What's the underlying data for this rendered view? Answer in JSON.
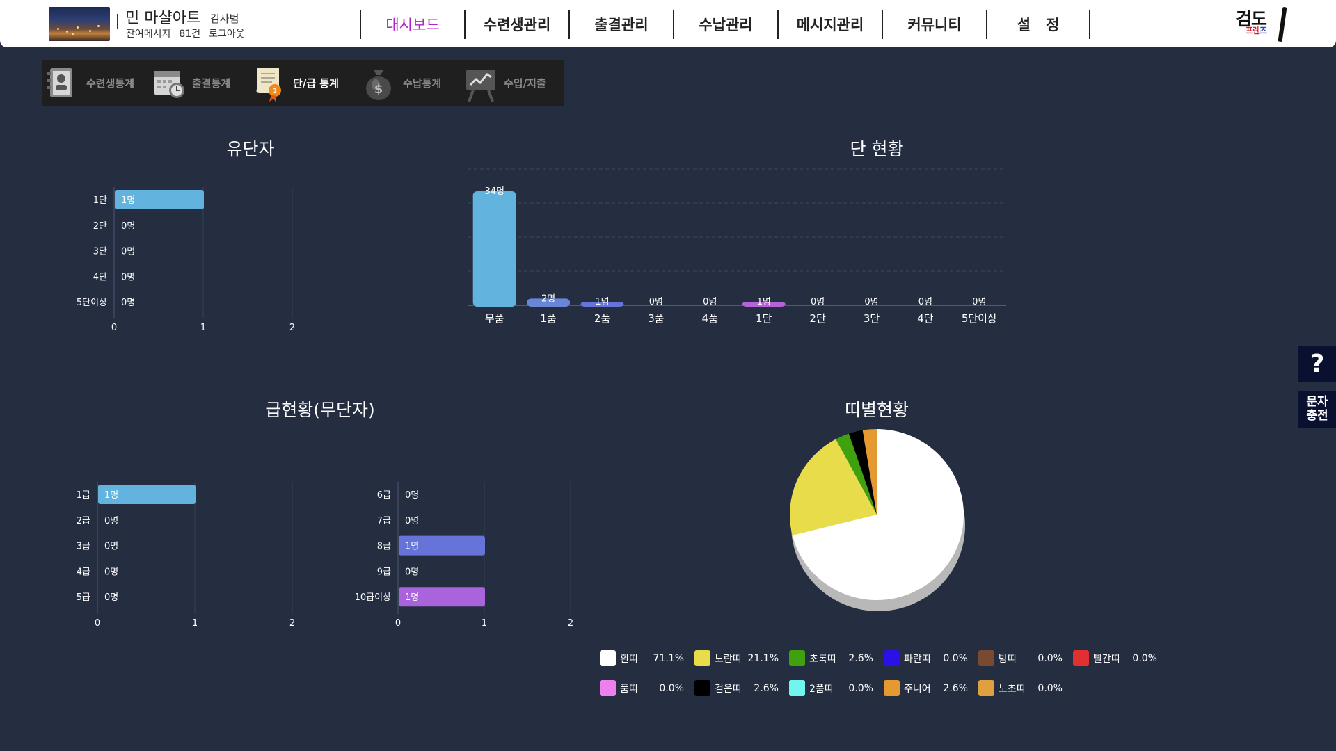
{
  "header": {
    "gym_name": "민 마샬아트",
    "owner": "김사범",
    "remaining_label": "잔여메시지",
    "remaining_count": "81건",
    "logout": "로그아웃",
    "nav": [
      "대시보드",
      "수련생관리",
      "출결관리",
      "수납관리",
      "메시지관리",
      "커뮤니티",
      "설   정"
    ],
    "logo_top": "검도",
    "logo_bottom_red": "프렌",
    "logo_bottom_blue": "즈"
  },
  "stat_tabs": [
    {
      "label": "수련생통계",
      "icon": "id-card-icon"
    },
    {
      "label": "출결통계",
      "icon": "calendar-clock-icon"
    },
    {
      "label": "단/급 통계",
      "icon": "certificate-icon"
    },
    {
      "label": "수납통계",
      "icon": "money-bag-icon"
    },
    {
      "label": "수입/지출",
      "icon": "chart-board-icon"
    }
  ],
  "active_tab": 2,
  "side": {
    "help": "?",
    "sms_line1": "문자",
    "sms_line2": "충전"
  },
  "colors": {
    "background": "#252d40",
    "header": "#ffffff",
    "active_nav": "#b121c9",
    "bar_blue": "#62b3dd",
    "bar_indigo": "#6673d8",
    "bar_purple": "#a963db"
  },
  "chart_data": [
    {
      "id": "yudanja",
      "type": "bar",
      "orientation": "horizontal",
      "title": "유단자",
      "categories": [
        "1단",
        "2단",
        "3단",
        "4단",
        "5단이상"
      ],
      "values": [
        1,
        0,
        0,
        0,
        0
      ],
      "data_labels": [
        "1명",
        "0명",
        "0명",
        "0명",
        "0명"
      ],
      "xlim": [
        0,
        2
      ],
      "xticks": [
        "0",
        "1",
        "2"
      ],
      "color": "#62b3dd"
    },
    {
      "id": "dan_status",
      "type": "bar",
      "title": "단 현황",
      "categories": [
        "무품",
        "1품",
        "2품",
        "3품",
        "4품",
        "1단",
        "2단",
        "3단",
        "4단",
        "5단이상"
      ],
      "values": [
        34,
        2,
        1,
        0,
        0,
        1,
        0,
        0,
        0,
        0
      ],
      "data_labels": [
        "34명",
        "2명",
        "1명",
        "0명",
        "0명",
        "1명",
        "0명",
        "0명",
        "0명",
        "0명"
      ],
      "ylim": [
        0,
        34
      ],
      "grid": true,
      "colors": [
        "#62b3dd",
        "#6985d8",
        "#6673d8",
        "#6a6bd8",
        "#7a67d8",
        "#b463d8",
        "#c060c0",
        "#c85aa8",
        "#cf5a95",
        "#d55c85"
      ]
    },
    {
      "id": "geup_status",
      "type": "bar",
      "orientation": "horizontal",
      "title": "급현황(무단자)",
      "panels": [
        {
          "categories": [
            "1급",
            "2급",
            "3급",
            "4급",
            "5급"
          ],
          "values": [
            1,
            0,
            0,
            0,
            0
          ],
          "data_labels": [
            "1명",
            "0명",
            "0명",
            "0명",
            "0명"
          ],
          "colors": [
            "#62b3dd",
            "#62b3dd",
            "#62b3dd",
            "#62b3dd",
            "#62b3dd"
          ]
        },
        {
          "categories": [
            "6급",
            "7급",
            "8급",
            "9급",
            "10급이상"
          ],
          "values": [
            0,
            0,
            1,
            0,
            1
          ],
          "data_labels": [
            "0명",
            "0명",
            "1명",
            "0명",
            "1명"
          ],
          "colors": [
            "#6673d8",
            "#6673d8",
            "#6673d8",
            "#8f6ad9",
            "#a963db"
          ]
        }
      ],
      "xlim": [
        0,
        2
      ],
      "xticks": [
        "0",
        "1",
        "2"
      ]
    },
    {
      "id": "belt_status",
      "type": "pie",
      "title": "띠별현황",
      "slices": [
        {
          "name": "흰띠",
          "value": 71.1,
          "label": "71.1%",
          "color": "#ffffff"
        },
        {
          "name": "노란띠",
          "value": 21.1,
          "label": "21.1%",
          "color": "#e8dc4a"
        },
        {
          "name": "초록띠",
          "value": 2.6,
          "label": "2.6%",
          "color": "#3fa010"
        },
        {
          "name": "파란띠",
          "value": 0.0,
          "label": "0.0%",
          "color": "#2b10e8"
        },
        {
          "name": "밤띠",
          "value": 0.0,
          "label": "0.0%",
          "color": "#7a4a30"
        },
        {
          "name": "빨간띠",
          "value": 0.0,
          "label": "0.0%",
          "color": "#e03030"
        },
        {
          "name": "품띠",
          "value": 0.0,
          "label": "0.0%",
          "color": "#ee80ee"
        },
        {
          "name": "검은띠",
          "value": 2.6,
          "label": "2.6%",
          "color": "#000000"
        },
        {
          "name": "2품띠",
          "value": 0.0,
          "label": "0.0%",
          "color": "#70f5f0"
        },
        {
          "name": "주니어",
          "value": 2.6,
          "label": "2.6%",
          "color": "#e49a30"
        },
        {
          "name": "노초띠",
          "value": 0.0,
          "label": "0.0%",
          "color": "#e0a040"
        }
      ]
    }
  ]
}
